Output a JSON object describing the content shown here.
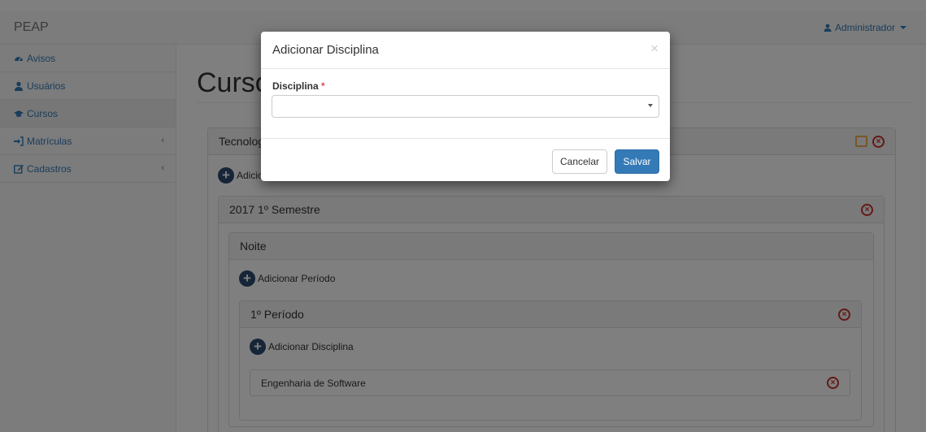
{
  "navbar": {
    "brand": "PEAP",
    "user": "Administrador"
  },
  "sidebar": {
    "items": [
      {
        "label": "Avisos",
        "icon": "dashboard-icon"
      },
      {
        "label": "Usuários",
        "icon": "user-icon"
      },
      {
        "label": "Cursos",
        "icon": "graduation-cap-icon"
      },
      {
        "label": "Matrículas",
        "icon": "sign-in-icon",
        "chevron": "‹"
      },
      {
        "label": "Cadastros",
        "icon": "edit-icon",
        "chevron": "‹"
      }
    ]
  },
  "page": {
    "title": "Curso",
    "course_title": "Tecnolog",
    "add_top_label": "Adicic",
    "semester_title": "2017 1º Semestre",
    "shift_title": "Noite",
    "add_period_label": "Adicionar Período",
    "period_title": "1º Período",
    "add_discipline_label": "Adicionar Disciplina",
    "discipline_name": "Engenharia de Software"
  },
  "modal": {
    "title": "Adicionar Disciplina",
    "close": "×",
    "field_label": "Disciplina",
    "required_mark": "*",
    "select_value": "",
    "cancel": "Cancelar",
    "save": "Salvar"
  },
  "colors": {
    "primary": "#337ab7",
    "danger": "#c9302c",
    "warning": "#f0ad4e",
    "plus": "#2c4a6e"
  }
}
